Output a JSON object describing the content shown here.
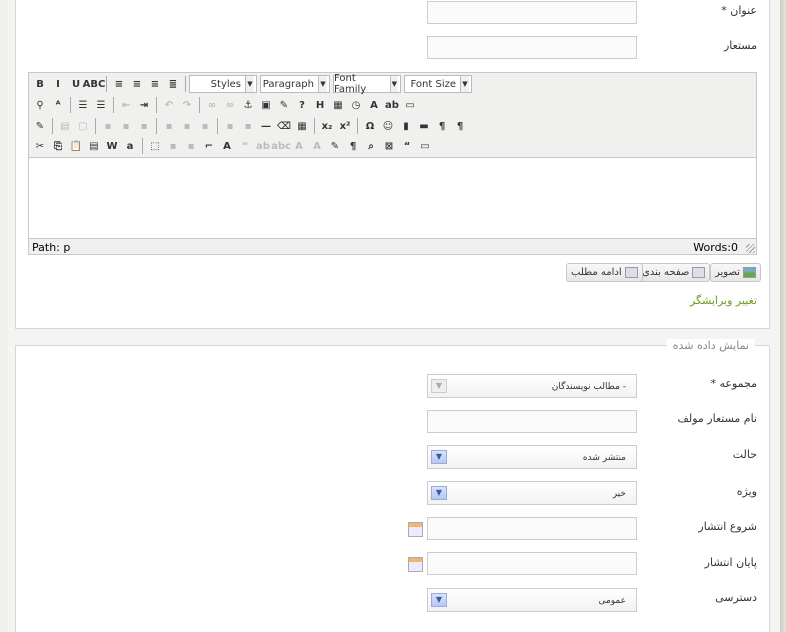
{
  "article": {
    "title_label": "عنوان *",
    "title_value": "",
    "alias_label": "مستعار",
    "alias_value": ""
  },
  "editor": {
    "dropdowns": [
      "Styles",
      "Paragraph",
      "Font Family",
      "Font Size"
    ],
    "row1_icons": [
      "bold-icon",
      "italic-icon",
      "underline-icon",
      "strikethrough-icon",
      "|",
      "align-left-icon",
      "align-center-icon",
      "align-right-icon",
      "align-justify-icon"
    ],
    "row2_icons": [
      "find-icon",
      "replace-icon",
      "|",
      "bullet-list-icon",
      "numbered-list-icon",
      "|",
      "outdent-icon",
      "indent-icon",
      "|",
      "undo-icon",
      "redo-icon",
      "|",
      "link-icon",
      "unlink-icon",
      "anchor-icon",
      "image-icon",
      "cleanup-icon",
      "help-icon",
      "html-icon",
      "insert-date-icon",
      "insert-time-icon",
      "text-color-icon",
      "highlight-color-icon",
      "fullscreen-icon"
    ],
    "row3_icons": [
      "edit-css-icon",
      "|",
      "row-props-icon",
      "cell-props-icon",
      "|",
      "insert-row-before-icon",
      "insert-row-after-icon",
      "delete-row-icon",
      "|",
      "insert-col-before-icon",
      "insert-col-after-icon",
      "delete-col-icon",
      "|",
      "split-cells-icon",
      "merge-cells-icon",
      "horizontal-rule-icon",
      "remove-format-icon",
      "visual-aid-icon",
      "|",
      "subscript-icon",
      "superscript-icon",
      "|",
      "special-char-icon",
      "emoticon-icon",
      "media-icon",
      "advanced-hr-icon",
      "ltr-icon",
      "rtl-icon"
    ],
    "row4_icons": [
      "cut-icon",
      "copy-icon",
      "paste-icon",
      "paste-text-icon",
      "paste-word-icon",
      "select-all-icon",
      "|",
      "insert-layer-icon",
      "move-forward-icon",
      "move-backward-icon",
      "absolute-icon",
      "styles-icon",
      "cite-icon",
      "abbr-icon",
      "acronym-icon",
      "insert-text-icon",
      "delete-text-icon",
      "attributes-icon",
      "show-blocks-icon",
      "preview-icon",
      "non-breaking-icon",
      "blockquote-icon",
      "template-icon"
    ],
    "path": "Path: p",
    "words": "Words:0"
  },
  "buttons": {
    "image": "تصویر",
    "pagebreak": "صفحه بندی",
    "readmore": "ادامه مطلب"
  },
  "toggle_editor": "تغییر ویرایشگر",
  "publishing": {
    "legend": "نمایش داده شده",
    "category_label": "مجموعه *",
    "category_value": "- مطالب نویسندگان",
    "author_alias_label": "نام مستعار مولف",
    "author_alias_value": "",
    "state_label": "حالت",
    "state_value": "منتشر شده",
    "featured_label": "ویژه",
    "featured_value": "خیر",
    "publish_up_label": "شروع انتشار",
    "publish_up_value": "",
    "publish_down_label": "پایان انتشار",
    "publish_down_value": "",
    "access_label": "دسترسی",
    "access_value": "عمومی"
  },
  "colors": {
    "link": "#6f9a1e",
    "select_arrow": "#b5c8f2"
  }
}
